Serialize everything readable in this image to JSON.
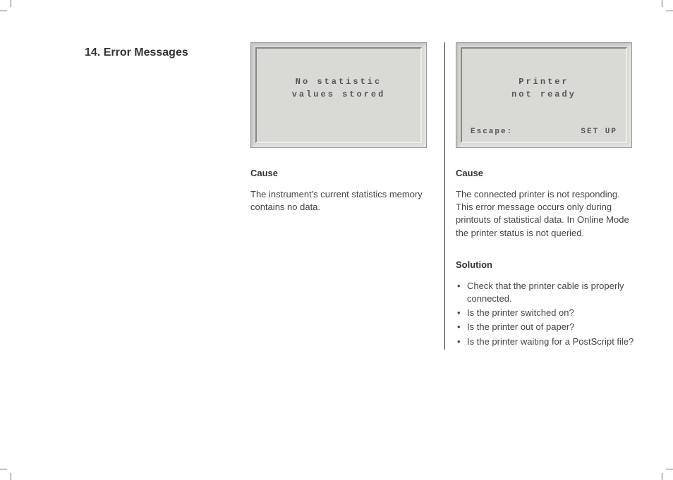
{
  "section_title": "14. Error Messages",
  "col1": {
    "lcd_line1": "No statistic",
    "lcd_line2": "values stored",
    "cause_heading": "Cause",
    "cause_text": "The instrument's current statistics memory contains no data."
  },
  "col2": {
    "lcd_line1": "Printer",
    "lcd_line2": "not ready",
    "lcd_escape_label": "Escape:",
    "lcd_setup_label": "SET UP",
    "cause_heading": "Cause",
    "cause_text": "The connected printer is not responding. This error message occurs only during printouts of statistical data. In Online Mode the printer status is not queried.",
    "solution_heading": "Solution",
    "solutions": [
      "Check that the printer cable is properly connected.",
      "Is the printer switched on?",
      "Is the printer out of paper?",
      "Is the printer waiting for a PostScript file?"
    ]
  }
}
